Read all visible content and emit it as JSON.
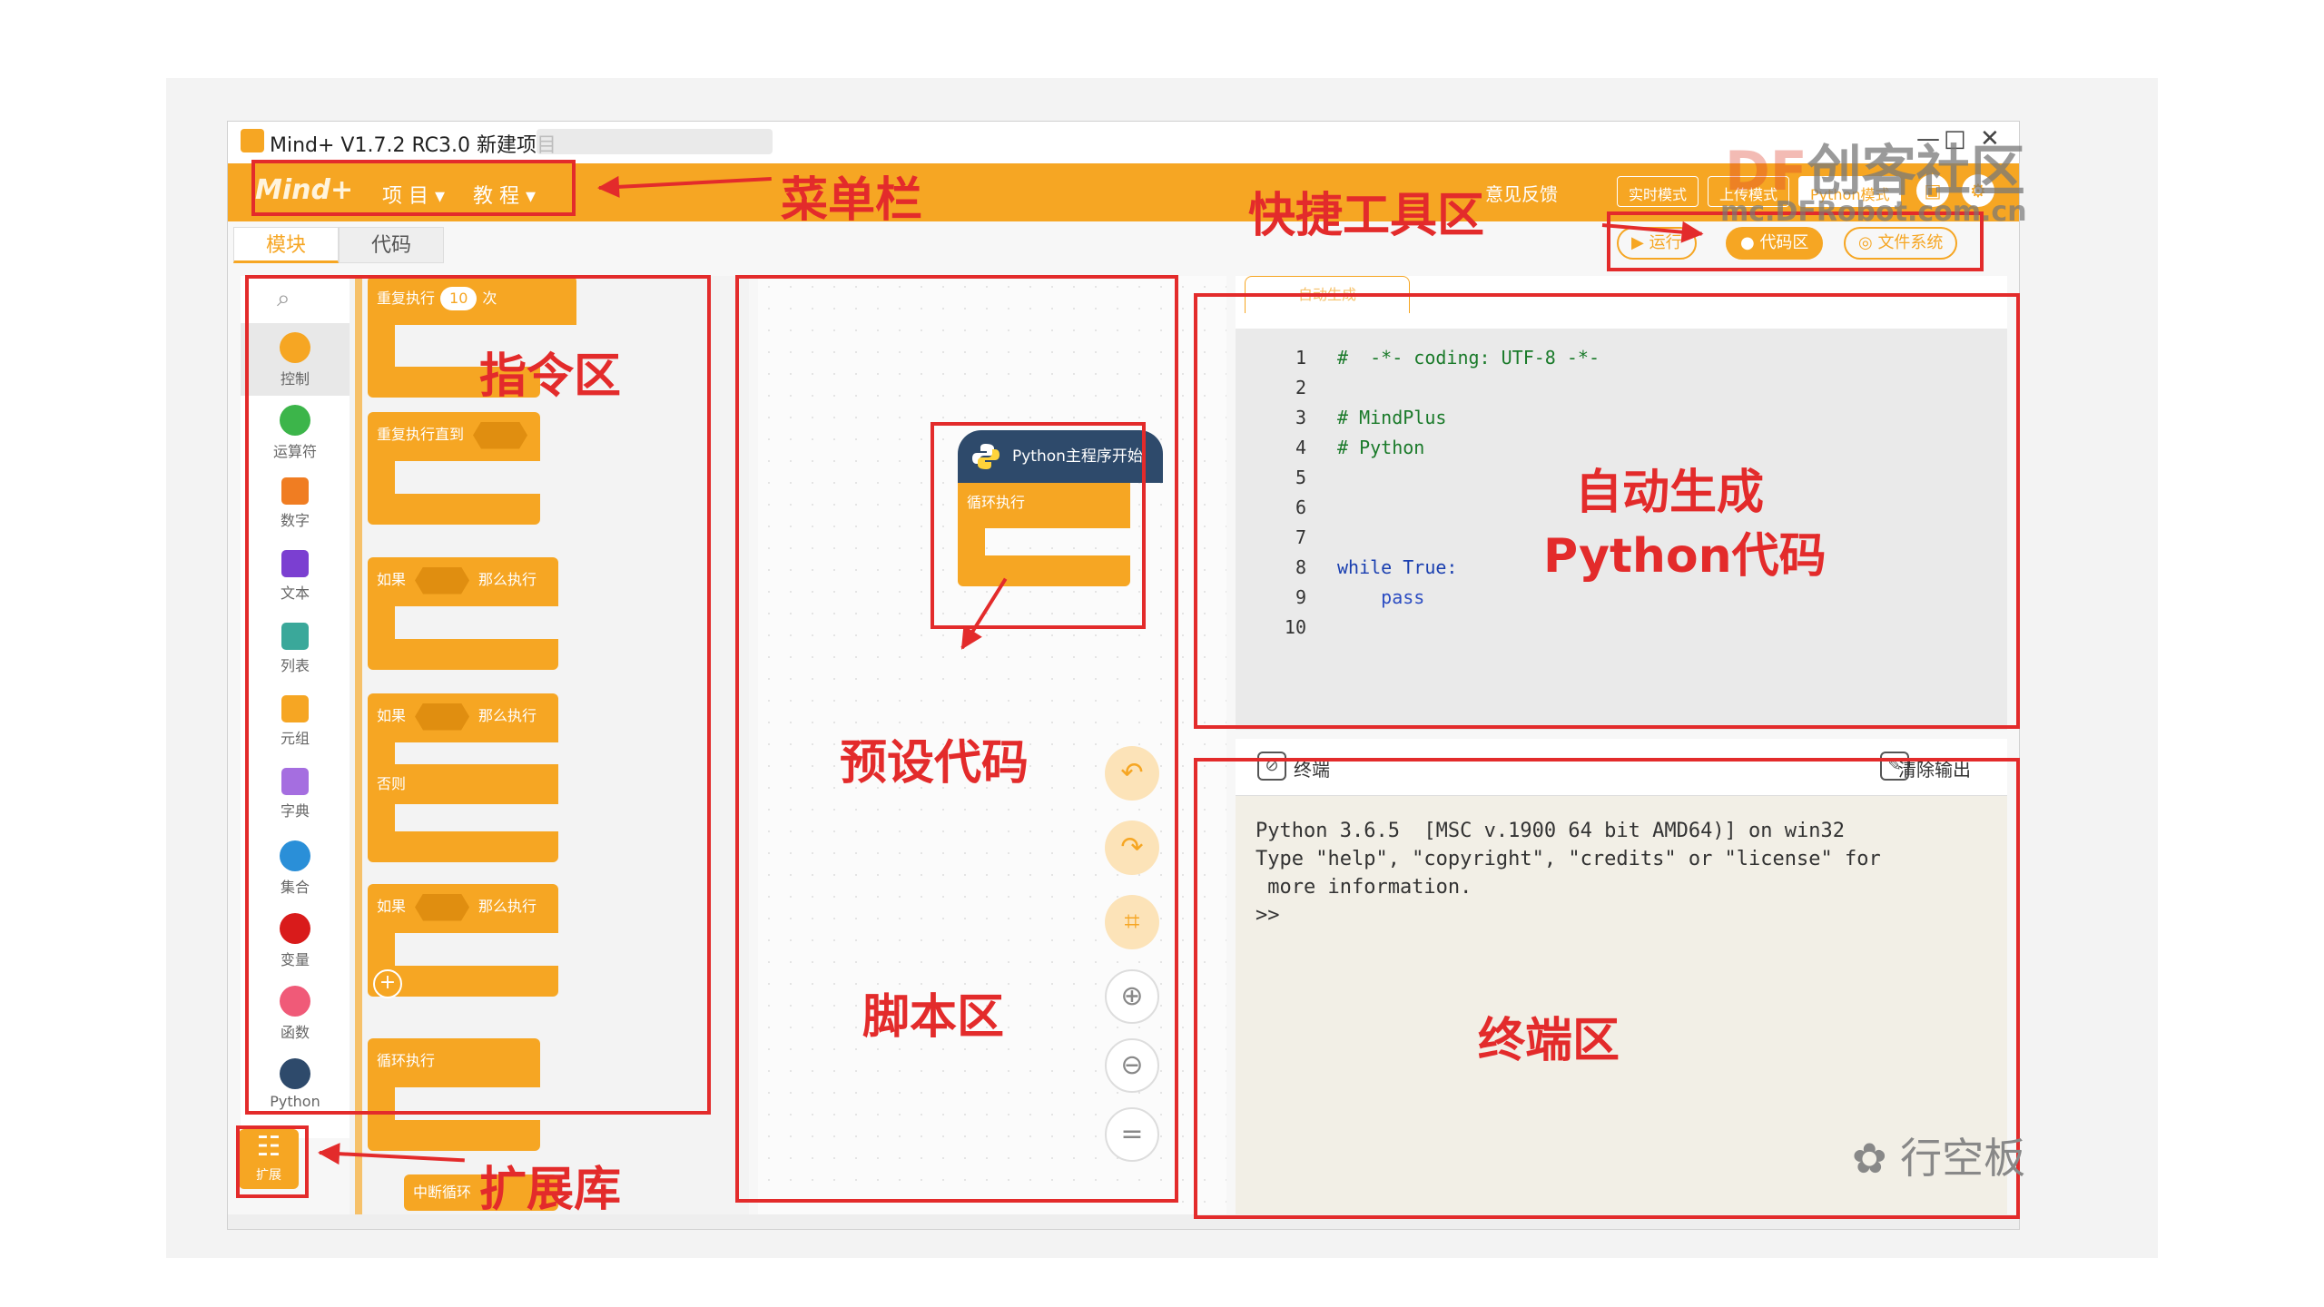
{
  "window": {
    "title": "Mind+ V1.7.2 RC3.0   新建项目",
    "min": "—",
    "max": "□",
    "close": "✕"
  },
  "menubar": {
    "logo": "Mind+",
    "project": "项 目 ▾",
    "tutorial": "教 程 ▾",
    "feedback": "意见反馈",
    "modes": [
      "实时模式",
      "上传模式",
      "Python模式"
    ]
  },
  "tabs": {
    "blocks": "模块",
    "code": "代码"
  },
  "quick_tools": {
    "run": "运行",
    "code_area": "代码区",
    "file_system": "文件系统"
  },
  "categories": [
    {
      "label": "控制",
      "color": "#f6a623"
    },
    {
      "label": "运算符",
      "color": "#3cb54a"
    },
    {
      "label": "数字",
      "color": "#f07d22"
    },
    {
      "label": "文本",
      "color": "#7b3fd1"
    },
    {
      "label": "列表",
      "color": "#3aa89a"
    },
    {
      "label": "元组",
      "color": "#f6a623"
    },
    {
      "label": "字典",
      "color": "#a56ee0"
    },
    {
      "label": "集合",
      "color": "#2a8fd8"
    },
    {
      "label": "变量",
      "color": "#d91b1b"
    },
    {
      "label": "函数",
      "color": "#f05a78"
    },
    {
      "label": "Python",
      "color": "#2e4a6b"
    }
  ],
  "palette": {
    "repeat": "重复执行",
    "repeat_count": "10",
    "times": "次",
    "repeat_until": "重复执行直到",
    "if": "如果",
    "then": "那么执行",
    "else": "否则",
    "loop": "循环执行",
    "break": "中断循环"
  },
  "script": {
    "hat": "Python主程序开始",
    "loop": "循环执行"
  },
  "code_tab": "自动生成",
  "code_lines": [
    {
      "n": "1",
      "t": "#  -*- coding: UTF-8 -*-",
      "c": "com"
    },
    {
      "n": "2",
      "t": "",
      "c": ""
    },
    {
      "n": "3",
      "t": "# MindPlus",
      "c": "com"
    },
    {
      "n": "4",
      "t": "# Python",
      "c": "com"
    },
    {
      "n": "5",
      "t": "",
      "c": ""
    },
    {
      "n": "6",
      "t": "",
      "c": ""
    },
    {
      "n": "7",
      "t": "",
      "c": ""
    },
    {
      "n": "8",
      "t": "while True:",
      "c": "kw"
    },
    {
      "n": "9",
      "t": "    pass",
      "c": "def"
    },
    {
      "n": "10",
      "t": "",
      "c": ""
    }
  ],
  "terminal": {
    "title": "终端",
    "clear": "清除输出",
    "output": "Python 3.6.5  [MSC v.1900 64 bit AMD64)] on win32\nType \"help\", \"copyright\", \"credits\" or \"license\" for\n more information.\n>>"
  },
  "extension": "扩展",
  "annotations": {
    "menubar": "菜单栏",
    "quicktools": "快捷工具区",
    "blocks": "指令区",
    "autogen1": "自动生成",
    "autogen2": "Python代码",
    "preset": "预设代码",
    "script": "脚本区",
    "terminal": "终端区",
    "extlib": "扩展库"
  },
  "watermark": {
    "df": "DF",
    "community": "创客社区",
    "site": "mc.DFRobot.com.cn",
    "brand": "行空板"
  },
  "colors": {
    "accent": "#f6a623",
    "annotation": "#e32b2b",
    "python_hat": "#2e4a6b"
  }
}
